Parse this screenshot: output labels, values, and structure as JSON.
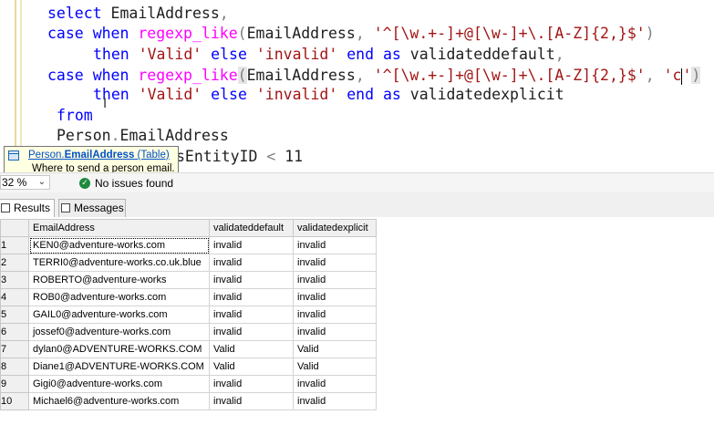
{
  "editor": {
    "lines": [
      [
        "kw",
        "select",
        " ",
        "EmailAddress",
        ",op"
      ],
      [],
      [],
      [],
      [],
      [],
      [],
      []
    ],
    "line1": {
      "kw": "select",
      "t1": " EmailAddress",
      "comma": ","
    },
    "line2": {
      "kw1": "case",
      "kw2": "when",
      "fn": "regexp_like",
      "p1": "(",
      "t1": "EmailAddress",
      "c1": ",",
      "str": "'^[\\w.+-]+@[\\w-]+\\.[A-Z]{2,}$'",
      "p2": ")"
    },
    "line3": {
      "kw1": "then",
      "str1": "'Valid'",
      "kw2": "else",
      "str2": "'invalid'",
      "kw3": "end",
      "kw4": "as",
      "t1": "validateddefault",
      "comma": ","
    },
    "line4": {
      "kw1": "case",
      "kw2": "when",
      "fn": "regexp_like",
      "p1": "(",
      "t1": "EmailAddress",
      "c1": ",",
      "str": "'^[\\w.+-]+@[\\w-]+\\.[A-Z]{2,}$'",
      "c2": ",",
      "str2a": "'c",
      "str2b": "'",
      "p2": ")"
    },
    "line5": {
      "kw1": "then",
      "str1": "'Valid'",
      "kw2": "else",
      "str2": "'invalid'",
      "kw3": "end",
      "kw4": "as",
      "t1": "validatedexplicit"
    },
    "line6": {
      "kw": "from"
    },
    "line7": {
      "t1": "Person",
      "dot": ".",
      "t2": "EmailAddress"
    },
    "line8": {
      "t1": "sEntityID",
      "op": "<",
      "t2": "11"
    }
  },
  "tooltip": {
    "link_schema": "Person.",
    "link_table": "EmailAddress",
    "link_suffix": " (Table)",
    "description": "Where to send a person email."
  },
  "statusbar": {
    "zoom": "32 %",
    "issues": "No issues found"
  },
  "tabs": {
    "results": "Results",
    "messages": "Messages"
  },
  "grid": {
    "columns": [
      "EmailAddress",
      "validateddefault",
      "validatedexplicit"
    ],
    "rows": [
      [
        "1",
        "KEN0@adventure-works.com",
        "invalid",
        "invalid"
      ],
      [
        "2",
        "TERRI0@adventure-works.co.uk.blue",
        "invalid",
        "invalid"
      ],
      [
        "3",
        "ROBERTO@adventure-works",
        "invalid",
        "invalid"
      ],
      [
        "4",
        "ROB0@adventure-works.com",
        "invalid",
        "invalid"
      ],
      [
        "5",
        "GAIL0@adventure-works.com",
        "invalid",
        "invalid"
      ],
      [
        "6",
        "jossef0@adventure-works.com",
        "invalid",
        "invalid"
      ],
      [
        "7",
        "dylan0@ADVENTURE-WORKS.COM",
        "Valid",
        "Valid"
      ],
      [
        "8",
        "Diane1@ADVENTURE-WORKS.COM",
        "Valid",
        "Valid"
      ],
      [
        "9",
        "Gigi0@adventure-works.com",
        "invalid",
        "invalid"
      ],
      [
        "10",
        "Michael6@adventure-works.com",
        "invalid",
        "invalid"
      ]
    ]
  }
}
